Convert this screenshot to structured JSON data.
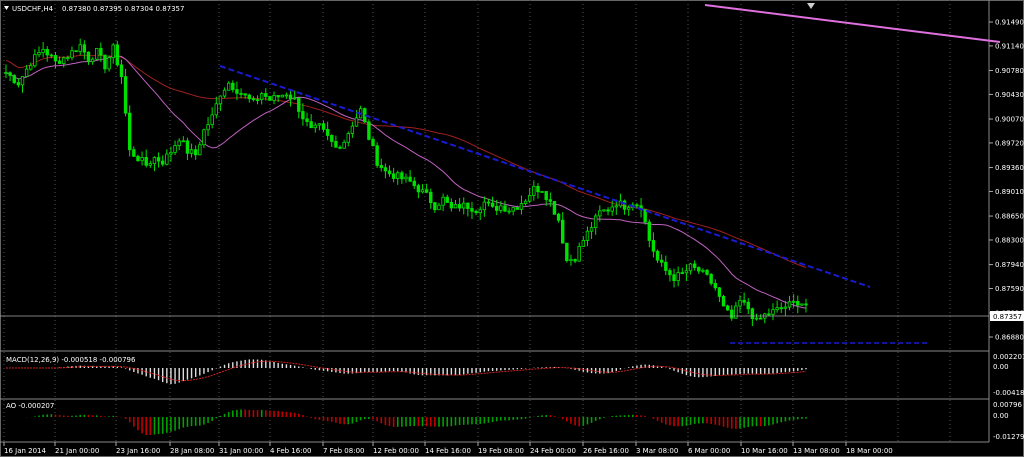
{
  "window": {
    "symbol_label": "USDCHF,H4",
    "ohlc": "0.87380 0.87395 0.87304 0.87357"
  },
  "colors": {
    "background": "#000000",
    "candles": "#00e000",
    "ma_fast": "#c060c0",
    "ma_slow": "#a02020",
    "trendline": "#1010c0",
    "upper_line": "#e070e0",
    "grid": "#888888",
    "macd_signal": "#d02020",
    "ao_up": "#00a000",
    "ao_down": "#c00000"
  },
  "price_axis": [
    "0.91490",
    "0.91140",
    "0.90780",
    "0.90430",
    "0.90070",
    "0.89720",
    "0.89360",
    "0.89010",
    "0.88650",
    "0.88300",
    "0.87940",
    "0.87590",
    "0.87230",
    "0.86880"
  ],
  "current_price": "0.87357",
  "time_axis": [
    "16 Jan 2014",
    "21 Jan 00:00",
    "23 Jan 16:00",
    "28 Jan 08:00",
    "31 Jan 00:00",
    "4 Feb 16:00",
    "7 Feb 08:00",
    "12 Feb 00:00",
    "14 Feb 16:00",
    "19 Feb 08:00",
    "24 Feb 00:00",
    "26 Feb 16:00",
    "3 Mar 08:00",
    "6 Mar 00:00",
    "10 Mar 16:00",
    "13 Mar 08:00",
    "18 Mar 00:00"
  ],
  "macd": {
    "label": "MACD(12,26,9) -0.000518 -0.000796",
    "axis": [
      "0.002201",
      "0.00",
      "-0.004186"
    ]
  },
  "ao": {
    "label": "AO -0.000207",
    "axis": [
      "0.00796",
      "0.00",
      "-0.012797"
    ]
  },
  "chart_data": {
    "type": "candlestick",
    "symbol": "USDCHF",
    "timeframe": "H4",
    "ylim": [
      0.8688,
      0.916
    ],
    "close_path": [
      [
        0,
        0.9075
      ],
      [
        3,
        0.906
      ],
      [
        6,
        0.909
      ],
      [
        9,
        0.911
      ],
      [
        12,
        0.909
      ],
      [
        15,
        0.91
      ],
      [
        18,
        0.9115
      ],
      [
        20,
        0.9095
      ],
      [
        22,
        0.9105
      ],
      [
        24,
        0.9085
      ],
      [
        26,
        0.911
      ],
      [
        28,
        0.907
      ],
      [
        30,
        0.896
      ],
      [
        32,
        0.895
      ],
      [
        34,
        0.894
      ],
      [
        36,
        0.895
      ],
      [
        38,
        0.8945
      ],
      [
        40,
        0.896
      ],
      [
        42,
        0.898
      ],
      [
        44,
        0.896
      ],
      [
        46,
        0.8955
      ],
      [
        48,
        0.899
      ],
      [
        50,
        0.901
      ],
      [
        52,
        0.9045
      ],
      [
        54,
        0.906
      ],
      [
        56,
        0.905
      ],
      [
        58,
        0.904
      ],
      [
        60,
        0.903
      ],
      [
        62,
        0.9045
      ],
      [
        64,
        0.9035
      ],
      [
        66,
        0.904
      ],
      [
        68,
        0.9045
      ],
      [
        70,
        0.9035
      ],
      [
        72,
        0.901
      ],
      [
        74,
        0.899
      ],
      [
        76,
        0.8995
      ],
      [
        78,
        0.898
      ],
      [
        80,
        0.8965
      ],
      [
        82,
        0.8975
      ],
      [
        84,
        0.9
      ],
      [
        86,
        0.902
      ],
      [
        88,
        0.898
      ],
      [
        90,
        0.8945
      ],
      [
        92,
        0.893
      ],
      [
        94,
        0.8925
      ],
      [
        96,
        0.892
      ],
      [
        98,
        0.8915
      ],
      [
        100,
        0.8905
      ],
      [
        102,
        0.8895
      ],
      [
        104,
        0.888
      ],
      [
        106,
        0.889
      ],
      [
        108,
        0.8875
      ],
      [
        110,
        0.888
      ],
      [
        112,
        0.888
      ],
      [
        114,
        0.8875
      ],
      [
        116,
        0.8885
      ],
      [
        118,
        0.8875
      ],
      [
        120,
        0.888
      ],
      [
        122,
        0.8875
      ],
      [
        124,
        0.888
      ],
      [
        126,
        0.889
      ],
      [
        128,
        0.8905
      ],
      [
        130,
        0.8905
      ],
      [
        132,
        0.8885
      ],
      [
        134,
        0.886
      ],
      [
        136,
        0.88
      ],
      [
        138,
        0.8805
      ],
      [
        140,
        0.883
      ],
      [
        142,
        0.885
      ],
      [
        144,
        0.887
      ],
      [
        146,
        0.8875
      ],
      [
        148,
        0.8885
      ],
      [
        150,
        0.888
      ],
      [
        152,
        0.8885
      ],
      [
        154,
        0.888
      ],
      [
        156,
        0.883
      ],
      [
        158,
        0.88
      ],
      [
        160,
        0.8785
      ],
      [
        162,
        0.8775
      ],
      [
        164,
        0.878
      ],
      [
        166,
        0.879
      ],
      [
        168,
        0.8785
      ],
      [
        170,
        0.8775
      ],
      [
        172,
        0.876
      ],
      [
        174,
        0.873
      ],
      [
        176,
        0.8715
      ],
      [
        178,
        0.874
      ],
      [
        180,
        0.873
      ],
      [
        182,
        0.871
      ],
      [
        184,
        0.872
      ],
      [
        186,
        0.8725
      ],
      [
        188,
        0.873
      ],
      [
        190,
        0.8735
      ],
      [
        192,
        0.874
      ],
      [
        194,
        0.8736
      ]
    ],
    "indicators": [
      "MA (fast)",
      "MA (slow)",
      "MACD(12,26,9)",
      "AO"
    ]
  }
}
